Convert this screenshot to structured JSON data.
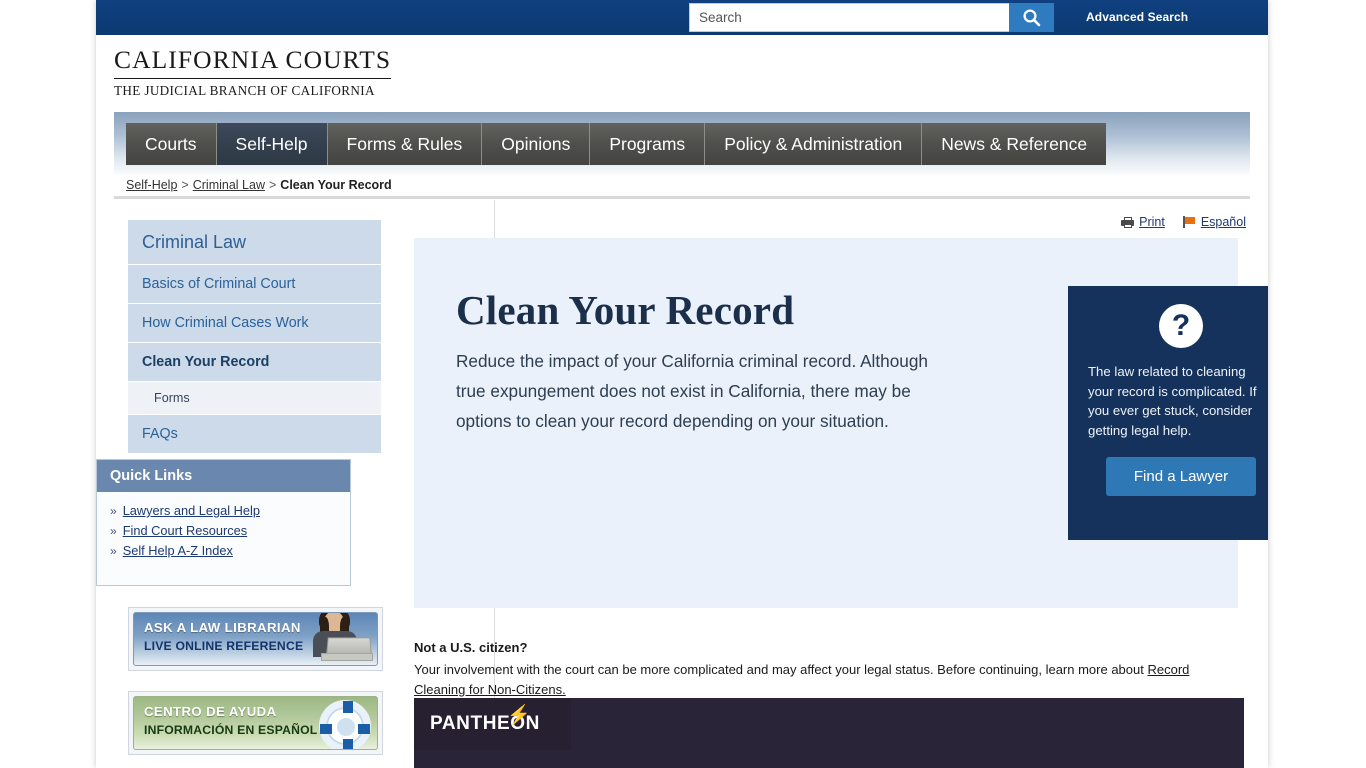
{
  "colors": {
    "topbar_blue": "#0d3f79",
    "search_button": "#2f7bc0",
    "nav_item": "#4f504c",
    "nav_active": "#34404e",
    "sidebar_item": "#ccdaea",
    "sidebar_link": "#2a6299",
    "quicklinks_header": "#6a87ad",
    "hero_bg": "#eaf1fa",
    "helpbox_bg": "#15325c",
    "find_lawyer_button": "#2e78b5",
    "pantheon_bg": "#2a2438",
    "pantheon_accent": "#f2b705"
  },
  "topbar": {
    "search_placeholder": "Search",
    "search_value": "",
    "search_icon": "search-icon",
    "advanced_search_label": "Advanced Search"
  },
  "logo": {
    "main": "CALIFORNIA COURTS",
    "sub": "THE JUDICIAL BRANCH OF CALIFORNIA"
  },
  "nav": {
    "items": [
      {
        "label": "Courts",
        "active": false
      },
      {
        "label": "Self-Help",
        "active": true
      },
      {
        "label": "Forms & Rules",
        "active": false
      },
      {
        "label": "Opinions",
        "active": false
      },
      {
        "label": "Programs",
        "active": false
      },
      {
        "label": "Policy & Administration",
        "active": false
      },
      {
        "label": "News & Reference",
        "active": false
      }
    ]
  },
  "breadcrumb": {
    "items": [
      {
        "label": "Self-Help",
        "link": true
      },
      {
        "label": "Criminal Law",
        "link": true
      },
      {
        "label": "Clean Your Record",
        "link": false
      }
    ],
    "separator": ">"
  },
  "sidebar": {
    "title": "Criminal Law",
    "items": [
      {
        "label": "Basics of Criminal Court",
        "current": false,
        "sub": false
      },
      {
        "label": "How Criminal Cases Work",
        "current": false,
        "sub": false
      },
      {
        "label": "Clean Your Record",
        "current": true,
        "sub": false
      },
      {
        "label": "Forms",
        "current": false,
        "sub": true
      },
      {
        "label": "FAQs",
        "current": false,
        "sub": false
      }
    ]
  },
  "quick_links": {
    "header": "Quick Links",
    "bullet": "»",
    "items": [
      {
        "label": "Lawyers and Legal Help"
      },
      {
        "label": "Find Court Resources"
      },
      {
        "label": "Self Help A-Z Index"
      }
    ]
  },
  "promos": [
    {
      "id": "ask-a-law-librarian",
      "line1": "ASK A LAW LIBRARIAN",
      "line2": "LIVE ONLINE REFERENCE",
      "art": "librarian-photo"
    },
    {
      "id": "centro-de-ayuda",
      "line1": "CENTRO DE AYUDA",
      "line2": "INFORMACIÓN EN ESPAÑOL",
      "art": "life-ring-icon"
    }
  ],
  "utility": {
    "print_label": "Print",
    "print_icon": "printer-icon",
    "espanol_label": "Español",
    "espanol_icon": "flag-icon"
  },
  "hero": {
    "title": "Clean Your Record",
    "paragraph": "Reduce the impact of your California criminal record. Although true expungement does not exist in California, there may be options to clean your record depending on your situation.",
    "helpbox": {
      "icon": "question-mark-icon",
      "icon_glyph": "?",
      "text": "The law related to cleaning your record is complicated. If you ever get stuck, consider getting legal help.",
      "button_label": "Find a Lawyer"
    }
  },
  "noncitizen": {
    "heading": "Not a U.S. citizen?",
    "body_before": "Your involvement with the court can be more complicated and may affect your legal status.  Before continuing, learn more about ",
    "link_label": "Record Cleaning for Non-Citizens."
  },
  "pantheon": {
    "wordmark": "PANTHEON",
    "bolt_glyph": "⚡"
  }
}
